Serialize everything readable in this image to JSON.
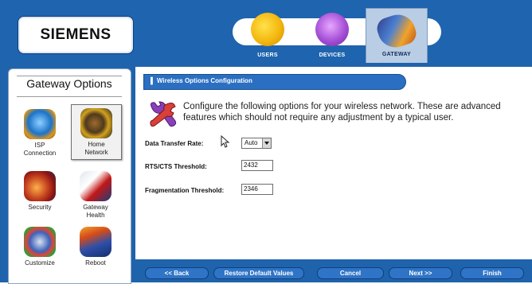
{
  "header": {
    "logo": "SIEMENS",
    "nav": [
      {
        "label": "USERS",
        "icon": "users-icon"
      },
      {
        "label": "DEVICES",
        "icon": "devices-icon"
      },
      {
        "label": "GATEWAY",
        "icon": "gateway-icon",
        "selected": true
      }
    ]
  },
  "sidebar": {
    "title": "Gateway Options",
    "items": [
      {
        "label_line1": "ISP",
        "label_line2": "Connection",
        "icon": "isp-connection-icon"
      },
      {
        "label_line1": "Home",
        "label_line2": "Network",
        "icon": "home-network-icon",
        "selected": true
      },
      {
        "label_line1": "Security",
        "label_line2": "",
        "icon": "security-icon"
      },
      {
        "label_line1": "Gateway",
        "label_line2": "Health",
        "icon": "gateway-health-icon"
      },
      {
        "label_line1": "Customize",
        "label_line2": "",
        "icon": "customize-icon"
      },
      {
        "label_line1": "Reboot",
        "label_line2": "",
        "icon": "reboot-icon"
      }
    ]
  },
  "main": {
    "section_title": "Wireless Options Configuration",
    "intro": "Configure the following options for your wireless network. These are advanced features which should not require any adjustment by a typical user.",
    "fields": {
      "data_rate": {
        "label": "Data Transfer Rate:",
        "value": "Auto"
      },
      "rts": {
        "label": "RTS/CTS Threshold:",
        "value": "2432"
      },
      "frag": {
        "label": "Fragmentation Threshold:",
        "value": "2346"
      }
    }
  },
  "footer": {
    "back": "<< Back",
    "restore": "Restore Default Values",
    "cancel": "Cancel",
    "next": "Next >>",
    "finish": "Finish"
  },
  "colors": {
    "brand_blue": "#1f63ac",
    "button_blue": "#2f74c6",
    "selected_tab": "#b9cde5"
  }
}
